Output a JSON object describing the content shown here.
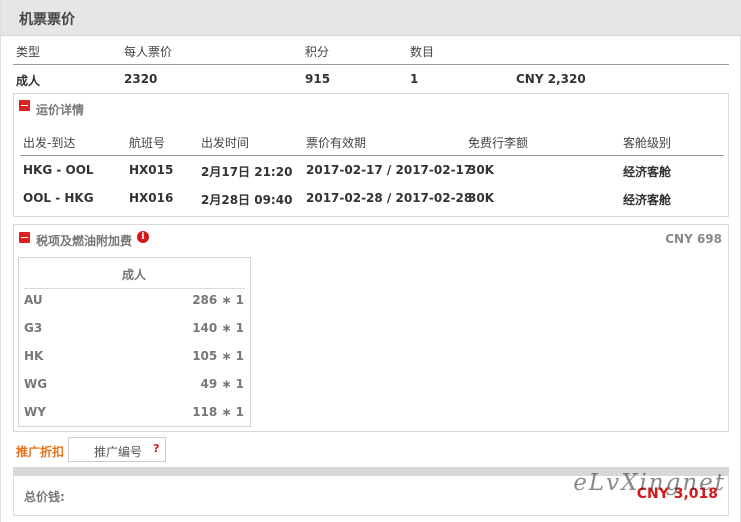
{
  "header": {
    "title": "机票票价"
  },
  "fare": {
    "columns": [
      "类型",
      "每人票价",
      "积分",
      "数目"
    ],
    "row": {
      "type": "成人",
      "price": "2320",
      "points": "915",
      "count": "1",
      "total": "CNY 2,320"
    }
  },
  "fare_detail": {
    "title": "运价详情",
    "columns": [
      "出发-到达",
      "航班号",
      "出发时间",
      "票价有效期",
      "免费行李额",
      "客舱级别"
    ],
    "rows": [
      {
        "route": "HKG - OOL",
        "flight": "HX015",
        "departure": "2月17日 21:20",
        "validity": "2017-02-17 / 2017-02-17",
        "baggage": "30K",
        "cabin": "经济客舱"
      },
      {
        "route": "OOL - HKG",
        "flight": "HX016",
        "departure": "2月28日 09:40",
        "validity": "2017-02-28 / 2017-02-28",
        "baggage": "30K",
        "cabin": "经济客舱"
      }
    ]
  },
  "taxes": {
    "title": "税项及燃油附加费",
    "info_icon": "i",
    "total": "CNY 698",
    "passenger": "成人",
    "items": [
      {
        "code": "AU",
        "value": "286 ∗ 1"
      },
      {
        "code": "G3",
        "value": "140 ∗ 1"
      },
      {
        "code": "HK",
        "value": "105 ∗ 1"
      },
      {
        "code": "WG",
        "value": "49 ∗ 1"
      },
      {
        "code": "WY",
        "value": "118 ∗ 1"
      }
    ]
  },
  "promo": {
    "label": "推广折扣",
    "placeholder": "推广编号",
    "help": "?"
  },
  "total": {
    "label": "总价钱:",
    "value": "CNY 3,018"
  },
  "watermark": "eLvXingnet"
}
